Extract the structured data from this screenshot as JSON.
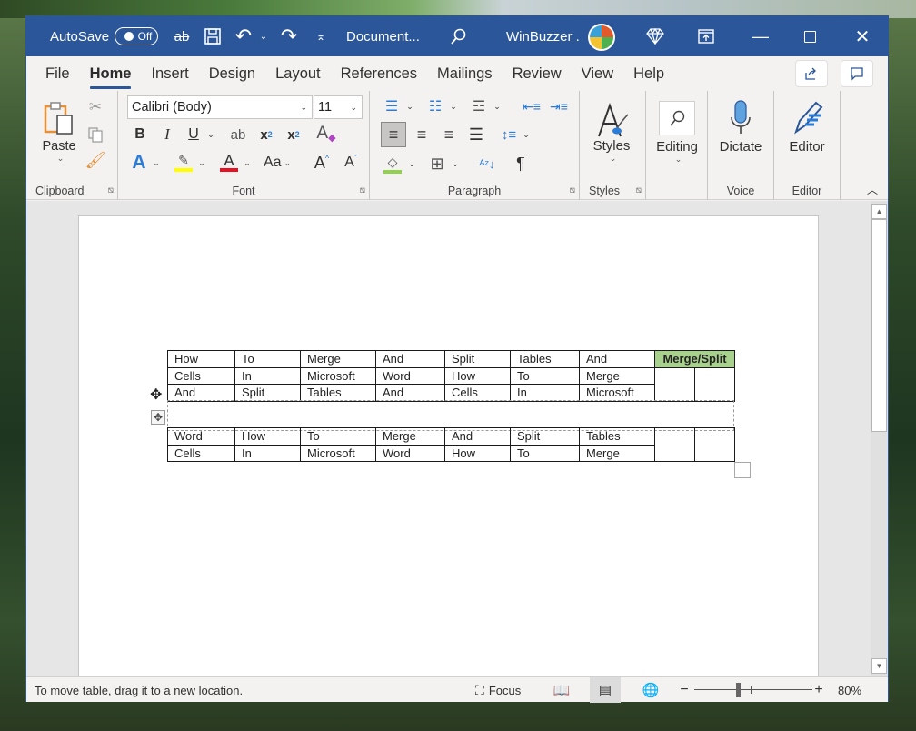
{
  "titlebar": {
    "autosave_label": "AutoSave",
    "autosave_state": "Off",
    "document_title": "Document...",
    "user_name": "WinBuzzer .",
    "icons": [
      "strikethrough-ab-icon",
      "save-icon",
      "undo-icon",
      "redo-icon",
      "customize-qat-icon",
      "search-icon",
      "premium-diamond-icon",
      "ribbon-display-icon",
      "minimize-icon",
      "maximize-icon",
      "close-icon"
    ]
  },
  "tabs": [
    "File",
    "Home",
    "Insert",
    "Design",
    "Layout",
    "References",
    "Mailings",
    "Review",
    "View",
    "Help"
  ],
  "active_tab": "Home",
  "ribbon": {
    "clipboard": {
      "label": "Clipboard",
      "paste": "Paste"
    },
    "font": {
      "label": "Font",
      "font_name": "Calibri (Body)",
      "font_size": "11",
      "highlight_color": "#ffff00",
      "font_color": "#e81123",
      "change_case": "Aa"
    },
    "paragraph": {
      "label": "Paragraph",
      "shading_color": "#92d050"
    },
    "styles": {
      "label": "Styles",
      "button": "Styles"
    },
    "editing": {
      "button": "Editing"
    },
    "voice": {
      "label": "Voice",
      "button": "Dictate"
    },
    "editor": {
      "label": "Editor",
      "button": "Editor"
    }
  },
  "document": {
    "table_top": [
      [
        "How",
        "To",
        "Merge",
        "And",
        "Split",
        "Tables",
        "And",
        "Merge/Split"
      ],
      [
        "Cells",
        "In",
        "Microsoft",
        "Word",
        "How",
        "To",
        "Merge"
      ],
      [
        "And",
        "Split",
        "Tables",
        "And",
        "Cells",
        "In",
        "Microsoft"
      ]
    ],
    "table_bottom": [
      [
        "Word",
        "How",
        "To",
        "Merge",
        "And",
        "Split",
        "Tables"
      ],
      [
        "Cells",
        "In",
        "Microsoft",
        "Word",
        "How",
        "To",
        "Merge"
      ]
    ],
    "header_highlight_color": "#a9d18e"
  },
  "status": {
    "message": "To move table, drag it to a new location.",
    "focus": "Focus",
    "zoom": "80%",
    "zoom_minus": "−",
    "zoom_plus": "+"
  }
}
